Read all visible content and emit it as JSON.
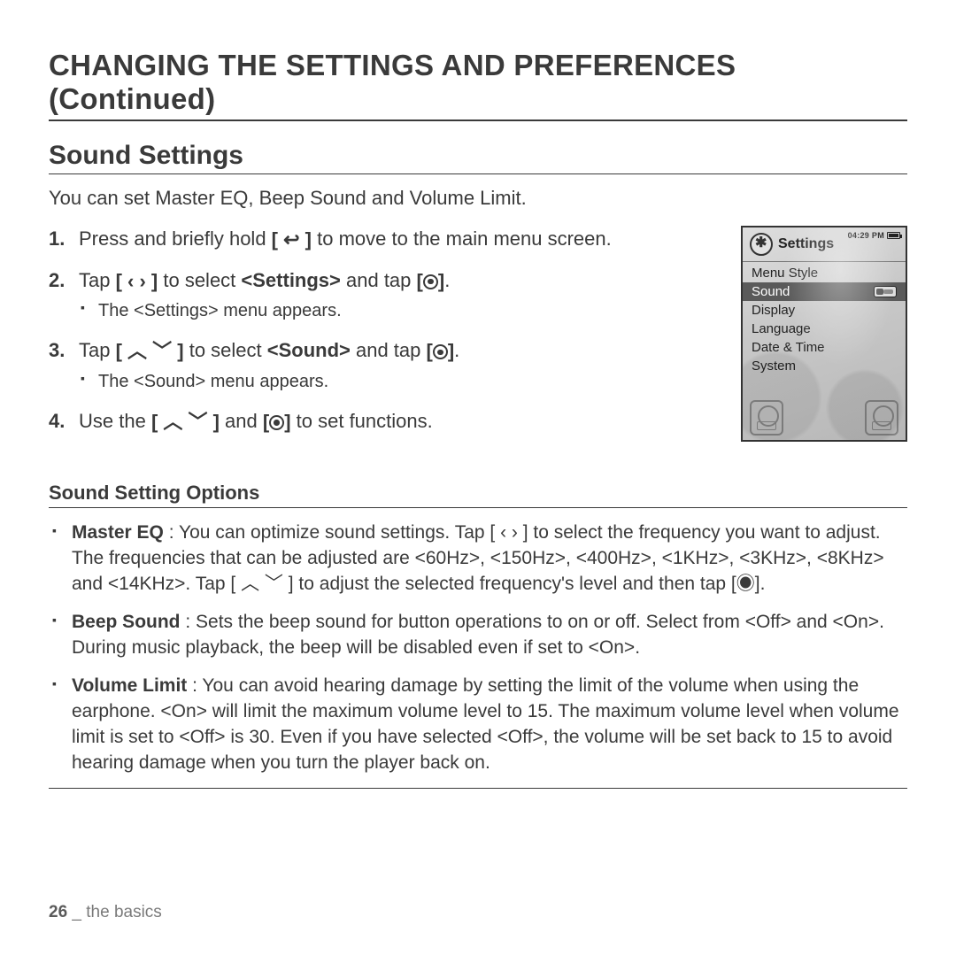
{
  "page_title": "CHANGING THE SETTINGS AND PREFERENCES (Continued)",
  "section_title": "Sound Settings",
  "intro": "You can set Master EQ, Beep Sound and Volume Limit.",
  "steps": [
    {
      "pre": "Press and briefly hold ",
      "btn": "[ ↩ ]",
      "post": " to move to the main menu screen."
    },
    {
      "pre": "Tap ",
      "btn": "[ ‹  › ]",
      "mid": " to select ",
      "bold": "<Settings>",
      "post2": " and tap ",
      "btn2": "CIRC",
      "sub": "The <Settings> menu appears."
    },
    {
      "pre": "Tap ",
      "btn": "[ ︿ ﹀ ]",
      "mid": " to select ",
      "bold": "<Sound>",
      "post2": " and tap ",
      "btn2": "CIRC",
      "sub": "The <Sound> menu appears."
    },
    {
      "pre": "Use the ",
      "btn": "[ ︿ ﹀ ]",
      "mid": " and ",
      "btn2": "CIRC",
      "post2": " to set functions."
    }
  ],
  "device": {
    "title": "Settings",
    "time": "04:29 PM",
    "items": [
      "Menu Style",
      "Sound",
      "Display",
      "Language",
      "Date & Time",
      "System"
    ],
    "selected": "Sound"
  },
  "options_title": "Sound Setting Options",
  "options": [
    {
      "name": "Master EQ",
      "text": " : You can optimize sound settings.\nTap [ ‹  › ] to select the frequency you want to adjust. The frequencies that can be adjusted are <60Hz>, <150Hz>, <400Hz>, <1KHz>, <3KHz>, <8KHz> and <14KHz>. Tap [ ︿ ﹀ ] to adjust the selected frequency's level and then tap [◉]."
    },
    {
      "name": "Beep Sound",
      "text": " : Sets the beep sound for button operations to on or off. Select from <Off> and <On>. During music playback, the beep will be disabled even if set to <On>."
    },
    {
      "name": "Volume Limit",
      "text": " : You can avoid hearing damage by setting the limit of the volume when using the earphone. <On> will limit the maximum volume level to 15. The maximum volume level when volume limit is set to <Off> is 30. Even if you have selected <Off>, the volume will be set back to 15 to avoid hearing damage when you turn the player back on."
    }
  ],
  "footer": {
    "page": "26",
    "sep": " _ ",
    "chapter": "the basics"
  }
}
